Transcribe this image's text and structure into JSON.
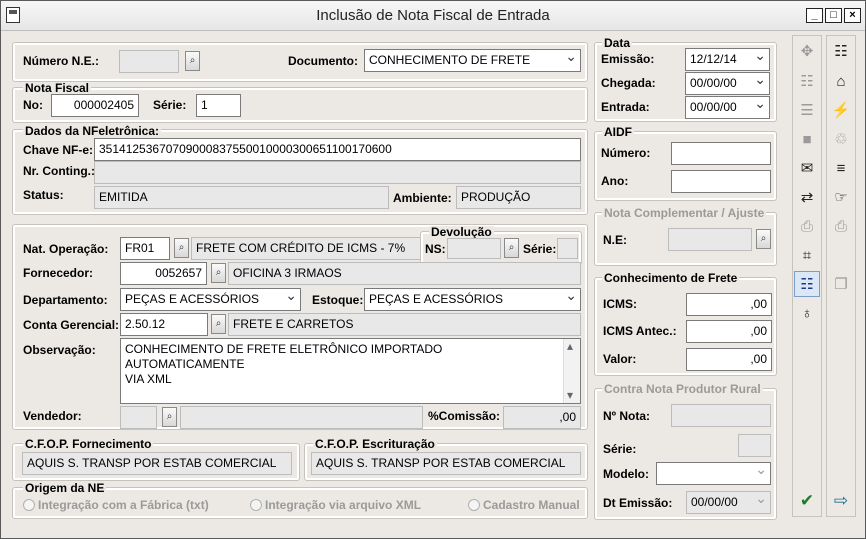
{
  "window": {
    "title": "Inclusão de Nota Fiscal de Entrada"
  },
  "top": {
    "numero_ne_label": "Número N.E.:",
    "documento_label": "Documento:",
    "documento_value": "CONHECIMENTO DE FRETE"
  },
  "nota_fiscal": {
    "legend": "Nota Fiscal",
    "no_label": "No:",
    "no_value": "000002405",
    "serie_label": "Série:",
    "serie_value": "1"
  },
  "nfe": {
    "legend": "Dados da NFeletrônica:",
    "chave_label": "Chave NF-e:",
    "chave_value": "35141253670709000837550010000300651100170600",
    "contig_label": "Nr. Conting.:",
    "status_label": "Status:",
    "status_value": "EMITIDA",
    "ambiente_label": "Ambiente:",
    "ambiente_value": "PRODUÇÃO"
  },
  "details": {
    "natop_label": "Nat. Operação:",
    "natop_code": "FR01",
    "natop_desc": "FRETE COM CRÉDITO DE ICMS - 7%",
    "devolucao_legend": "Devolução",
    "ns_label": "NS:",
    "dev_serie_label": "Série:",
    "fornecedor_label": "Fornecedor:",
    "fornecedor_code": "0052657",
    "fornecedor_name": "OFICINA 3 IRMAOS",
    "departamento_label": "Departamento:",
    "departamento_value": "PEÇAS E ACESSÓRIOS",
    "estoque_label": "Estoque:",
    "estoque_value": "PEÇAS E ACESSÓRIOS",
    "conta_label": "Conta Gerencial:",
    "conta_code": "2.50.12",
    "conta_desc": "FRETE E CARRETOS",
    "obs_label": "Observação:",
    "obs_line1": "CONHECIMENTO DE FRETE ELETRÔNICO IMPORTADO AUTOMATICAMENTE",
    "obs_line2": "VIA XML",
    "vendedor_label": "Vendedor:",
    "comissao_label": "%Comissão:",
    "comissao_value": ",00"
  },
  "cfop": {
    "fornecimento_legend": "C.F.O.P. Fornecimento",
    "fornecimento_value": "AQUIS S. TRANSP POR ESTAB COMERCIAL",
    "escrituracao_legend": "C.F.O.P. Escrituração",
    "escrituracao_value": "AQUIS S. TRANSP POR ESTAB COMERCIAL"
  },
  "origem": {
    "legend": "Origem da NE",
    "opt1": "Integração com a Fábrica (txt)",
    "opt2": "Integração via arquivo XML",
    "opt3": "Cadastro Manual"
  },
  "data": {
    "legend": "Data",
    "emissao_label": "Emissão:",
    "emissao_value": "12/12/14",
    "chegada_label": "Chegada:",
    "chegada_value": "00/00/00",
    "entrada_label": "Entrada:",
    "entrada_value": "00/00/00"
  },
  "aidf": {
    "legend": "AIDF",
    "numero_label": "Número:",
    "ano_label": "Ano:"
  },
  "complementar": {
    "legend": "Nota Complementar / Ajuste",
    "ne_label": "N.E:"
  },
  "frete": {
    "legend": "Conhecimento de Frete",
    "icms_label": "ICMS:",
    "icms_value": ",00",
    "icms_antec_label": "ICMS Antec.:",
    "icms_antec_value": ",00",
    "valor_label": "Valor:",
    "valor_value": ",00"
  },
  "produtor": {
    "legend": "Contra Nota Produtor Rural",
    "nota_label": "Nº Nota:",
    "serie_label": "Série:",
    "modelo_label": "Modelo:",
    "emissao_label": "Dt Emissão:",
    "emissao_value": "00/00/00"
  },
  "lookup_glyph": "⌕",
  "toolbar_left": [
    {
      "icon": "insert-row-icon",
      "glyph": "✥"
    },
    {
      "icon": "preview-icon",
      "glyph": "☷"
    },
    {
      "icon": "list-icon",
      "glyph": "☰"
    },
    {
      "icon": "stamp-icon",
      "glyph": "■"
    },
    {
      "icon": "money-icon",
      "glyph": "✉"
    },
    {
      "icon": "transfer-icon",
      "glyph": "⇄"
    },
    {
      "icon": "print-icon",
      "glyph": "⎙"
    },
    {
      "icon": "calculator-icon",
      "glyph": "⌗"
    },
    {
      "icon": "grid-icon",
      "glyph": "☷"
    },
    {
      "icon": "globe-icon",
      "glyph": "♁"
    }
  ],
  "toolbar_right": [
    {
      "icon": "table-icon",
      "glyph": "☷"
    },
    {
      "icon": "building-icon",
      "glyph": "⌂"
    },
    {
      "icon": "lightning-icon",
      "glyph": "⚡"
    },
    {
      "icon": "trash-icon",
      "glyph": "♲"
    },
    {
      "icon": "stack-icon",
      "glyph": "≡"
    },
    {
      "icon": "hand-icon",
      "glyph": "☞"
    },
    {
      "icon": "printer-icon",
      "glyph": "⎙"
    },
    {
      "icon": "folder-icon",
      "glyph": "❐"
    }
  ],
  "confirm_glyph": "✔",
  "exit_glyph": "⇨"
}
